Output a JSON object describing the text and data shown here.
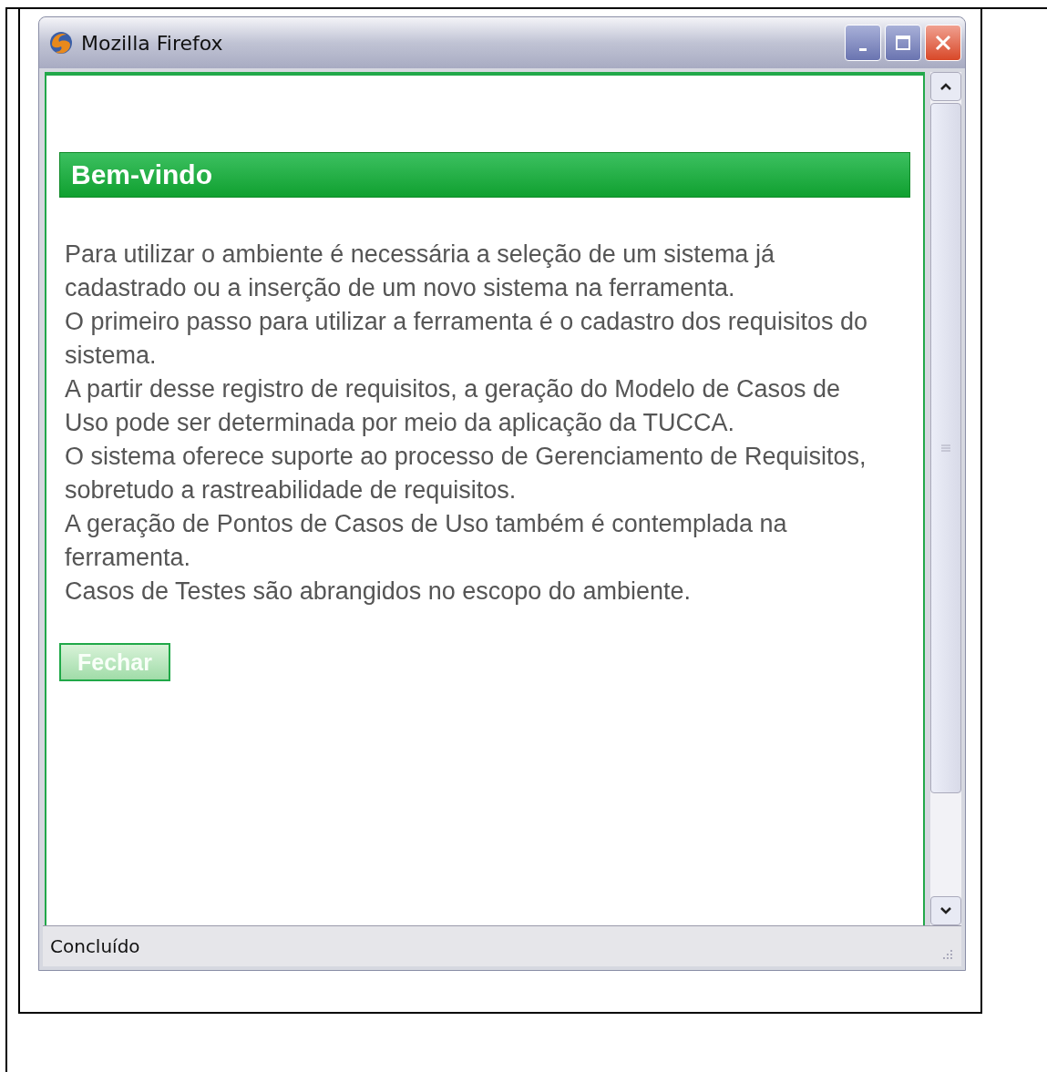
{
  "window": {
    "title": "Mozilla Firefox"
  },
  "page": {
    "heading": "Bem-vindo",
    "paragraphs": [
      "Para utilizar o ambiente é necessária a seleção de um sistema já cadastrado ou a inserção de um novo sistema na ferramenta.",
      "O primeiro passo para utilizar a ferramenta é o cadastro dos requisitos do sistema.",
      "A partir desse registro de requisitos, a geração do Modelo de Casos de Uso pode ser determinada por meio da aplicação da TUCCA.",
      "O sistema oferece suporte ao processo de Gerenciamento de Requisitos, sobretudo a rastreabilidade de requisitos.",
      "A geração de Pontos de Casos de Uso também é contemplada na ferramenta.",
      "Casos de Testes são abrangidos no escopo do ambiente."
    ],
    "button": "Fechar"
  },
  "status_bar": "Concluído"
}
